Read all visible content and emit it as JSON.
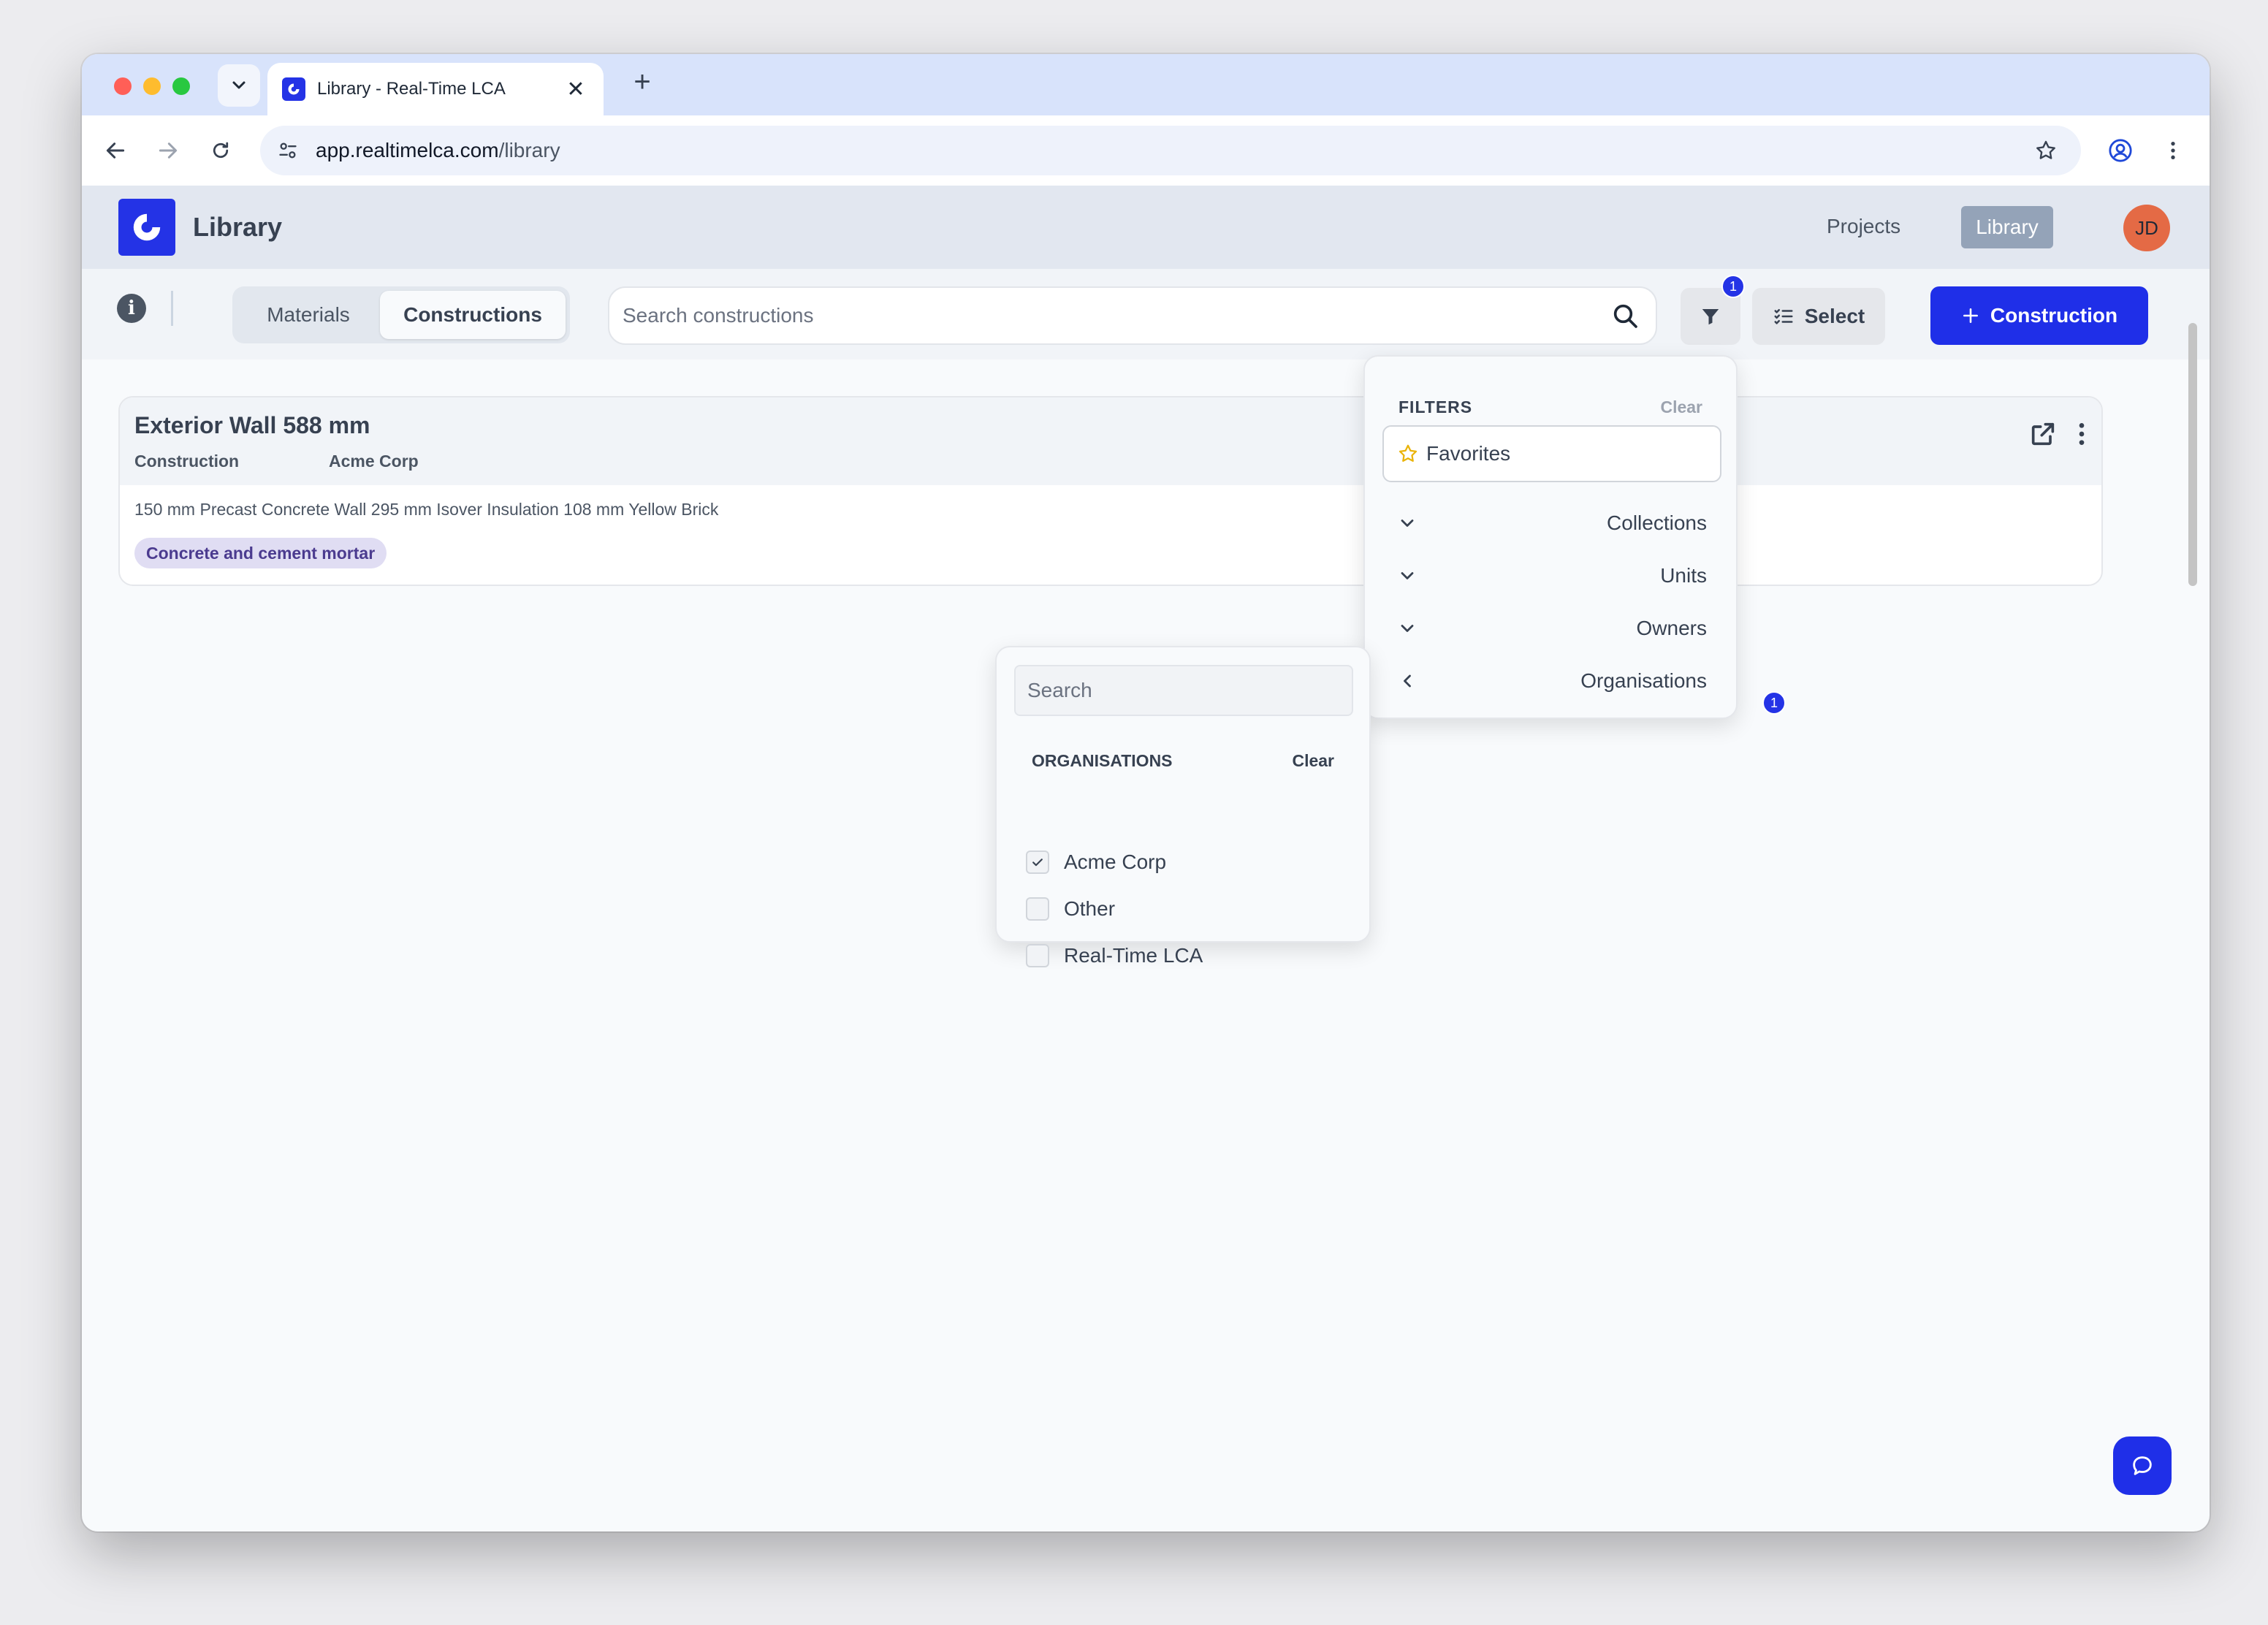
{
  "browser": {
    "tab_title": "Library - Real-Time LCA",
    "url_host": "app.realtimelca.com",
    "url_path": "/library",
    "close_tab": "✕",
    "new_tab": "+"
  },
  "app": {
    "title": "Library",
    "nav": {
      "projects": "Projects",
      "library": "Library"
    },
    "avatar_initials": "JD",
    "accent_color": "#1f2fe8"
  },
  "toolbar": {
    "segments": {
      "materials": "Materials",
      "constructions": "Constructions"
    },
    "search_placeholder": "Search constructions",
    "filter_badge": "1",
    "select_label": "Select",
    "add_label": "Construction"
  },
  "card": {
    "title": "Exterior Wall 588 mm",
    "type": "Construction",
    "organisation": "Acme Corp",
    "description": "150 mm Precast Concrete Wall 295 mm Isover Insulation 108 mm Yellow Brick",
    "tag": "Concrete and cement mortar"
  },
  "filters": {
    "heading": "FILTERS",
    "clear": "Clear",
    "favorites": "Favorites",
    "items": [
      {
        "label": "Collections",
        "chevron": "down"
      },
      {
        "label": "Units",
        "chevron": "down"
      },
      {
        "label": "Owners",
        "chevron": "down"
      },
      {
        "label": "Organisations",
        "chevron": "left",
        "badge": "1"
      }
    ]
  },
  "organisations_menu": {
    "search_placeholder": "Search",
    "heading": "ORGANISATIONS",
    "clear": "Clear",
    "options": [
      {
        "label": "Acme Corp",
        "checked": true
      },
      {
        "label": "Other",
        "checked": false
      },
      {
        "label": "Real-Time LCA",
        "checked": false
      }
    ]
  }
}
